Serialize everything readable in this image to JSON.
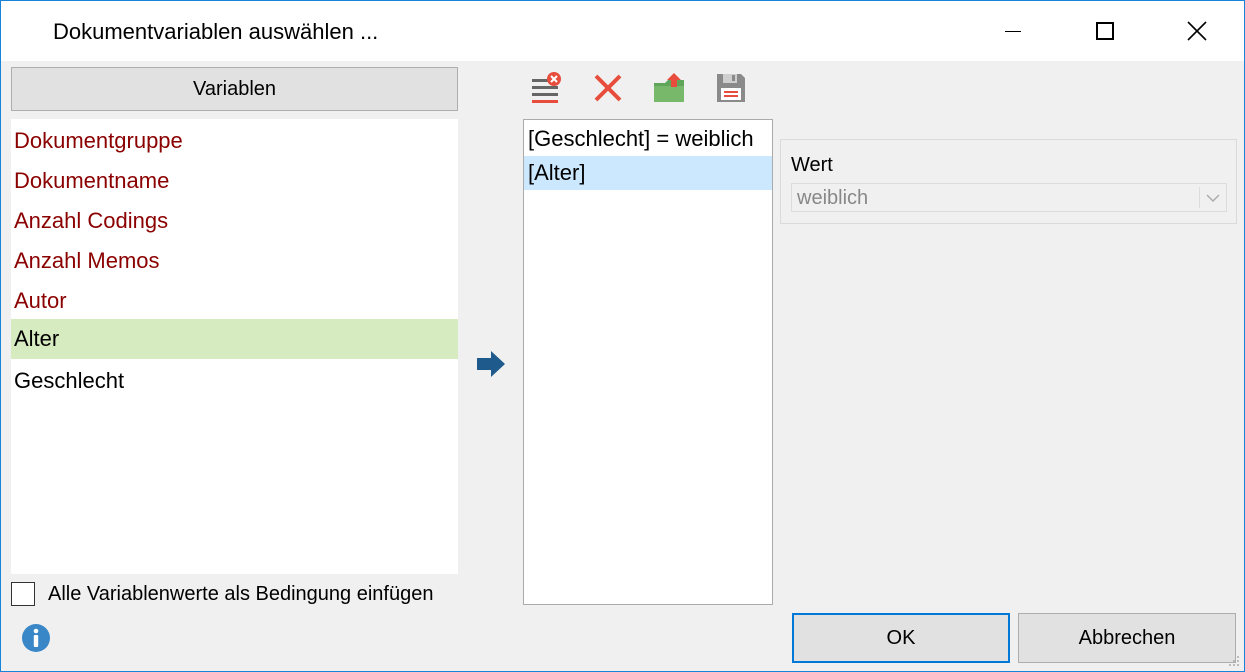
{
  "window": {
    "title": "Dokumentvariablen auswählen ...",
    "accent": "#1883d7"
  },
  "variables": {
    "header": "Variablen",
    "items": [
      {
        "label": "Dokumentgruppe",
        "kind": "system"
      },
      {
        "label": "Dokumentname",
        "kind": "system"
      },
      {
        "label": "Anzahl Codings",
        "kind": "system"
      },
      {
        "label": "Anzahl Memos",
        "kind": "system"
      },
      {
        "label": "Autor",
        "kind": "system"
      },
      {
        "label": "Alter",
        "kind": "user",
        "selected": true
      },
      {
        "label": "Geschlecht",
        "kind": "user"
      }
    ],
    "system_color": "#8b0000",
    "selected_color": "#d7ebc1"
  },
  "checkbox": {
    "label": "Alle Variablenwerte als Bedingung einfügen",
    "checked": false
  },
  "toolbar": {
    "icons": [
      "clear-list-icon",
      "delete-icon",
      "open-folder-icon",
      "save-icon"
    ]
  },
  "conditions": {
    "items": [
      {
        "label": "[Geschlecht] = weiblich",
        "selected": false
      },
      {
        "label": "[Alter]",
        "selected": true
      }
    ],
    "selected_color": "#cce8ff"
  },
  "wert": {
    "label": "Wert",
    "value": "weiblich"
  },
  "buttons": {
    "ok": "OK",
    "cancel": "Abbrechen"
  }
}
